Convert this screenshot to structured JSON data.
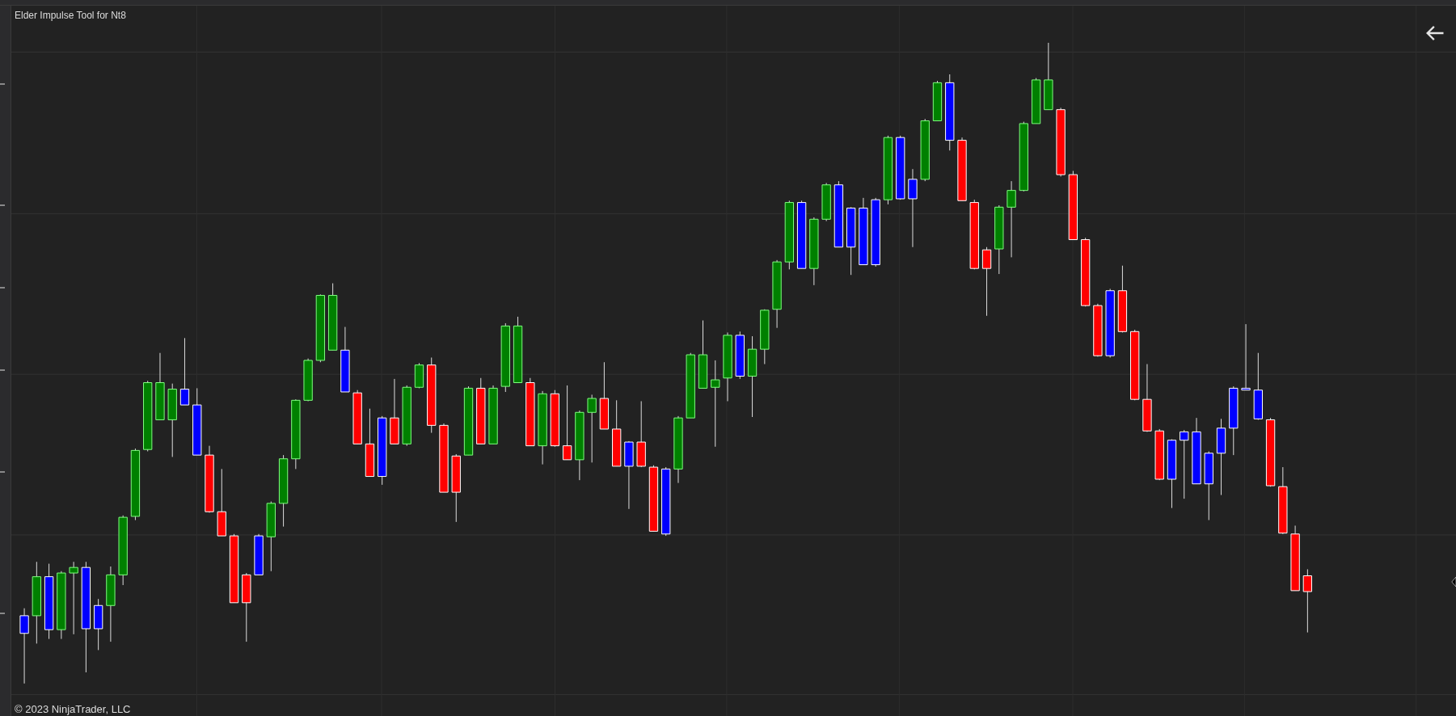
{
  "chart": {
    "title": "Elder Impulse Tool for Nt8"
  },
  "footer": {
    "copyright": "© 2023 NinjaTrader, LLC"
  }
}
